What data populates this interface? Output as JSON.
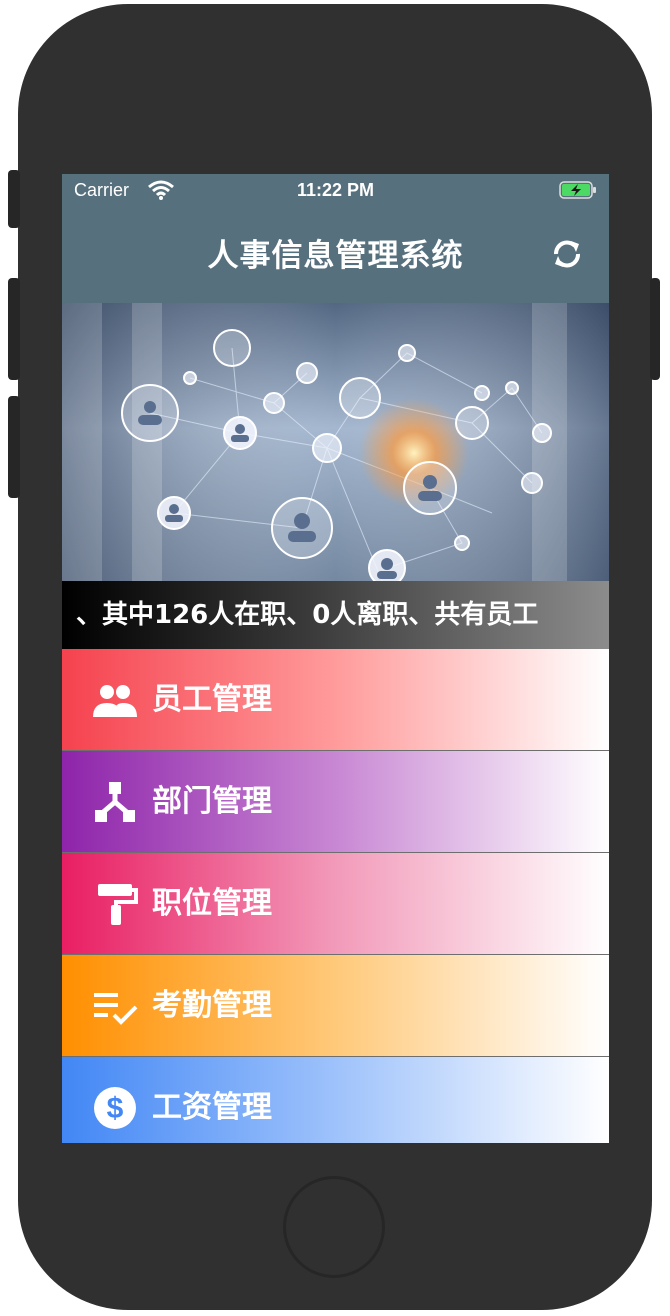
{
  "status_bar": {
    "carrier": "Carrier",
    "time": "11:22 PM"
  },
  "nav": {
    "title": "人事信息管理系统",
    "refresh_icon": "refresh-icon"
  },
  "ticker": {
    "text": "、其中126人在职、0人离职、共有员工"
  },
  "menu": {
    "items": [
      {
        "label": "员工管理",
        "icon": "people-icon",
        "color": "#f5424f"
      },
      {
        "label": "部门管理",
        "icon": "org-tree-icon",
        "color": "#8e24aa"
      },
      {
        "label": "职位管理",
        "icon": "paint-roller-icon",
        "color": "#e91e63"
      },
      {
        "label": "考勤管理",
        "icon": "checklist-icon",
        "color": "#ff8f00"
      },
      {
        "label": "工资管理",
        "icon": "dollar-icon",
        "color": "#4287f5"
      }
    ]
  }
}
